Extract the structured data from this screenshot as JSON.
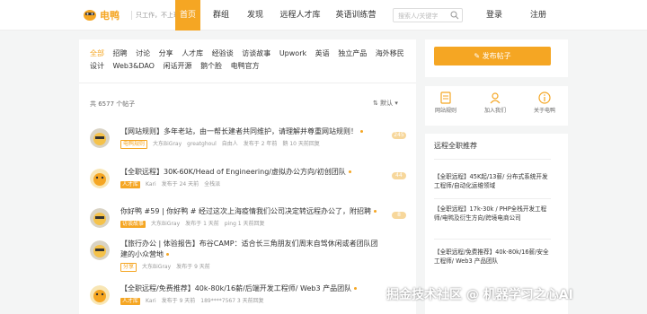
{
  "header": {
    "logo_text": "电鸭",
    "slogan": "只工作，不上班",
    "nav": [
      {
        "label": "首页",
        "active": true
      },
      {
        "label": "群组",
        "active": false
      },
      {
        "label": "发现",
        "active": false
      },
      {
        "label": "远程人才库",
        "active": false
      },
      {
        "label": "英语训练营",
        "active": false
      }
    ],
    "search_placeholder": "搜索人/关键字",
    "login": "登录",
    "register": "注册"
  },
  "tags": {
    "row1": [
      "全部",
      "招聘",
      "讨论",
      "分享",
      "人才库",
      "经验谈",
      "访谈故事",
      "Upwork",
      "英语",
      "独立产品",
      "海外移民"
    ],
    "row2": [
      "设计",
      "Web3&DAO",
      "闲话开源",
      "鹅个脸",
      "电鸭官方"
    ],
    "active": "全部"
  },
  "list": {
    "count": "共 6577 个帖子",
    "sort": "默认"
  },
  "posts": [
    {
      "title": "【网站规则】多年老站，由一帮长建者共同维护，请理解并尊重网站规则！",
      "badge": "电鸭规则",
      "badge_style": "talk",
      "author": "大东BiGray",
      "editor": "greatghoul",
      "time": "自由人",
      "extra": "发布于 2 年前",
      "extra2": "鹅  10 天前回复",
      "reply": "245"
    },
    {
      "title": "【全职远程】30K-60K/Head of Engineering/虚拟办公方向/初创团队",
      "badge": "人才库",
      "badge_style": "hot",
      "author": "Kari",
      "time": "发布于 24 天前",
      "extra": "全栈派",
      "extra2": "",
      "reply": "44"
    },
    {
      "title": "你好鸭 #59 | 你好鸭 # 经过这次上海疫情我们公司决定转远程办公了，附招聘",
      "badge": "访谈故事",
      "badge_style": "hot",
      "author": "大东BiGray",
      "time": "发布于 1 天前",
      "extra": "ping 1 天前回复",
      "extra2": "",
      "reply": "8"
    },
    {
      "title": "【旅行办公 | 体验报告】布谷CAMP：适合长三角朋友们周末自驾休闲或者团队团建的小众营地",
      "badge": "分享",
      "badge_style": "talk",
      "author": "大东BiGray",
      "time": "发布于 9 天前",
      "extra": "",
      "extra2": "",
      "reply": ""
    },
    {
      "title": "【全职远程/免费推荐】40k-80k/16薪/后端开发工程师/ Web3 产品团队",
      "badge": "人才库",
      "badge_style": "hot",
      "author": "Kari",
      "time": "发布于 9 天前",
      "extra": "189****7567 3 天前回复",
      "extra2": "",
      "reply": ""
    }
  ],
  "sidebar": {
    "publish": "发布帖子",
    "quick_links": [
      "网站规则",
      "加入我们",
      "关于电鸭"
    ],
    "jobs_title": "远程全职推荐",
    "jobs": [
      "【全职远程】45K起/13薪/ 分布式系统开发工程师/自动化运维领域",
      "【全职远程】17k-30k / PHP全栈开发工程师/电鸭及衍生方向/跨境电商公司",
      "【全职远程/免费推荐】40k-80k/16薪/安全工程师/ Web3 产品团队"
    ]
  },
  "watermark": "掘金技术社区 @ 机器学习之心AI",
  "colors": {
    "accent": "#f5a623"
  }
}
